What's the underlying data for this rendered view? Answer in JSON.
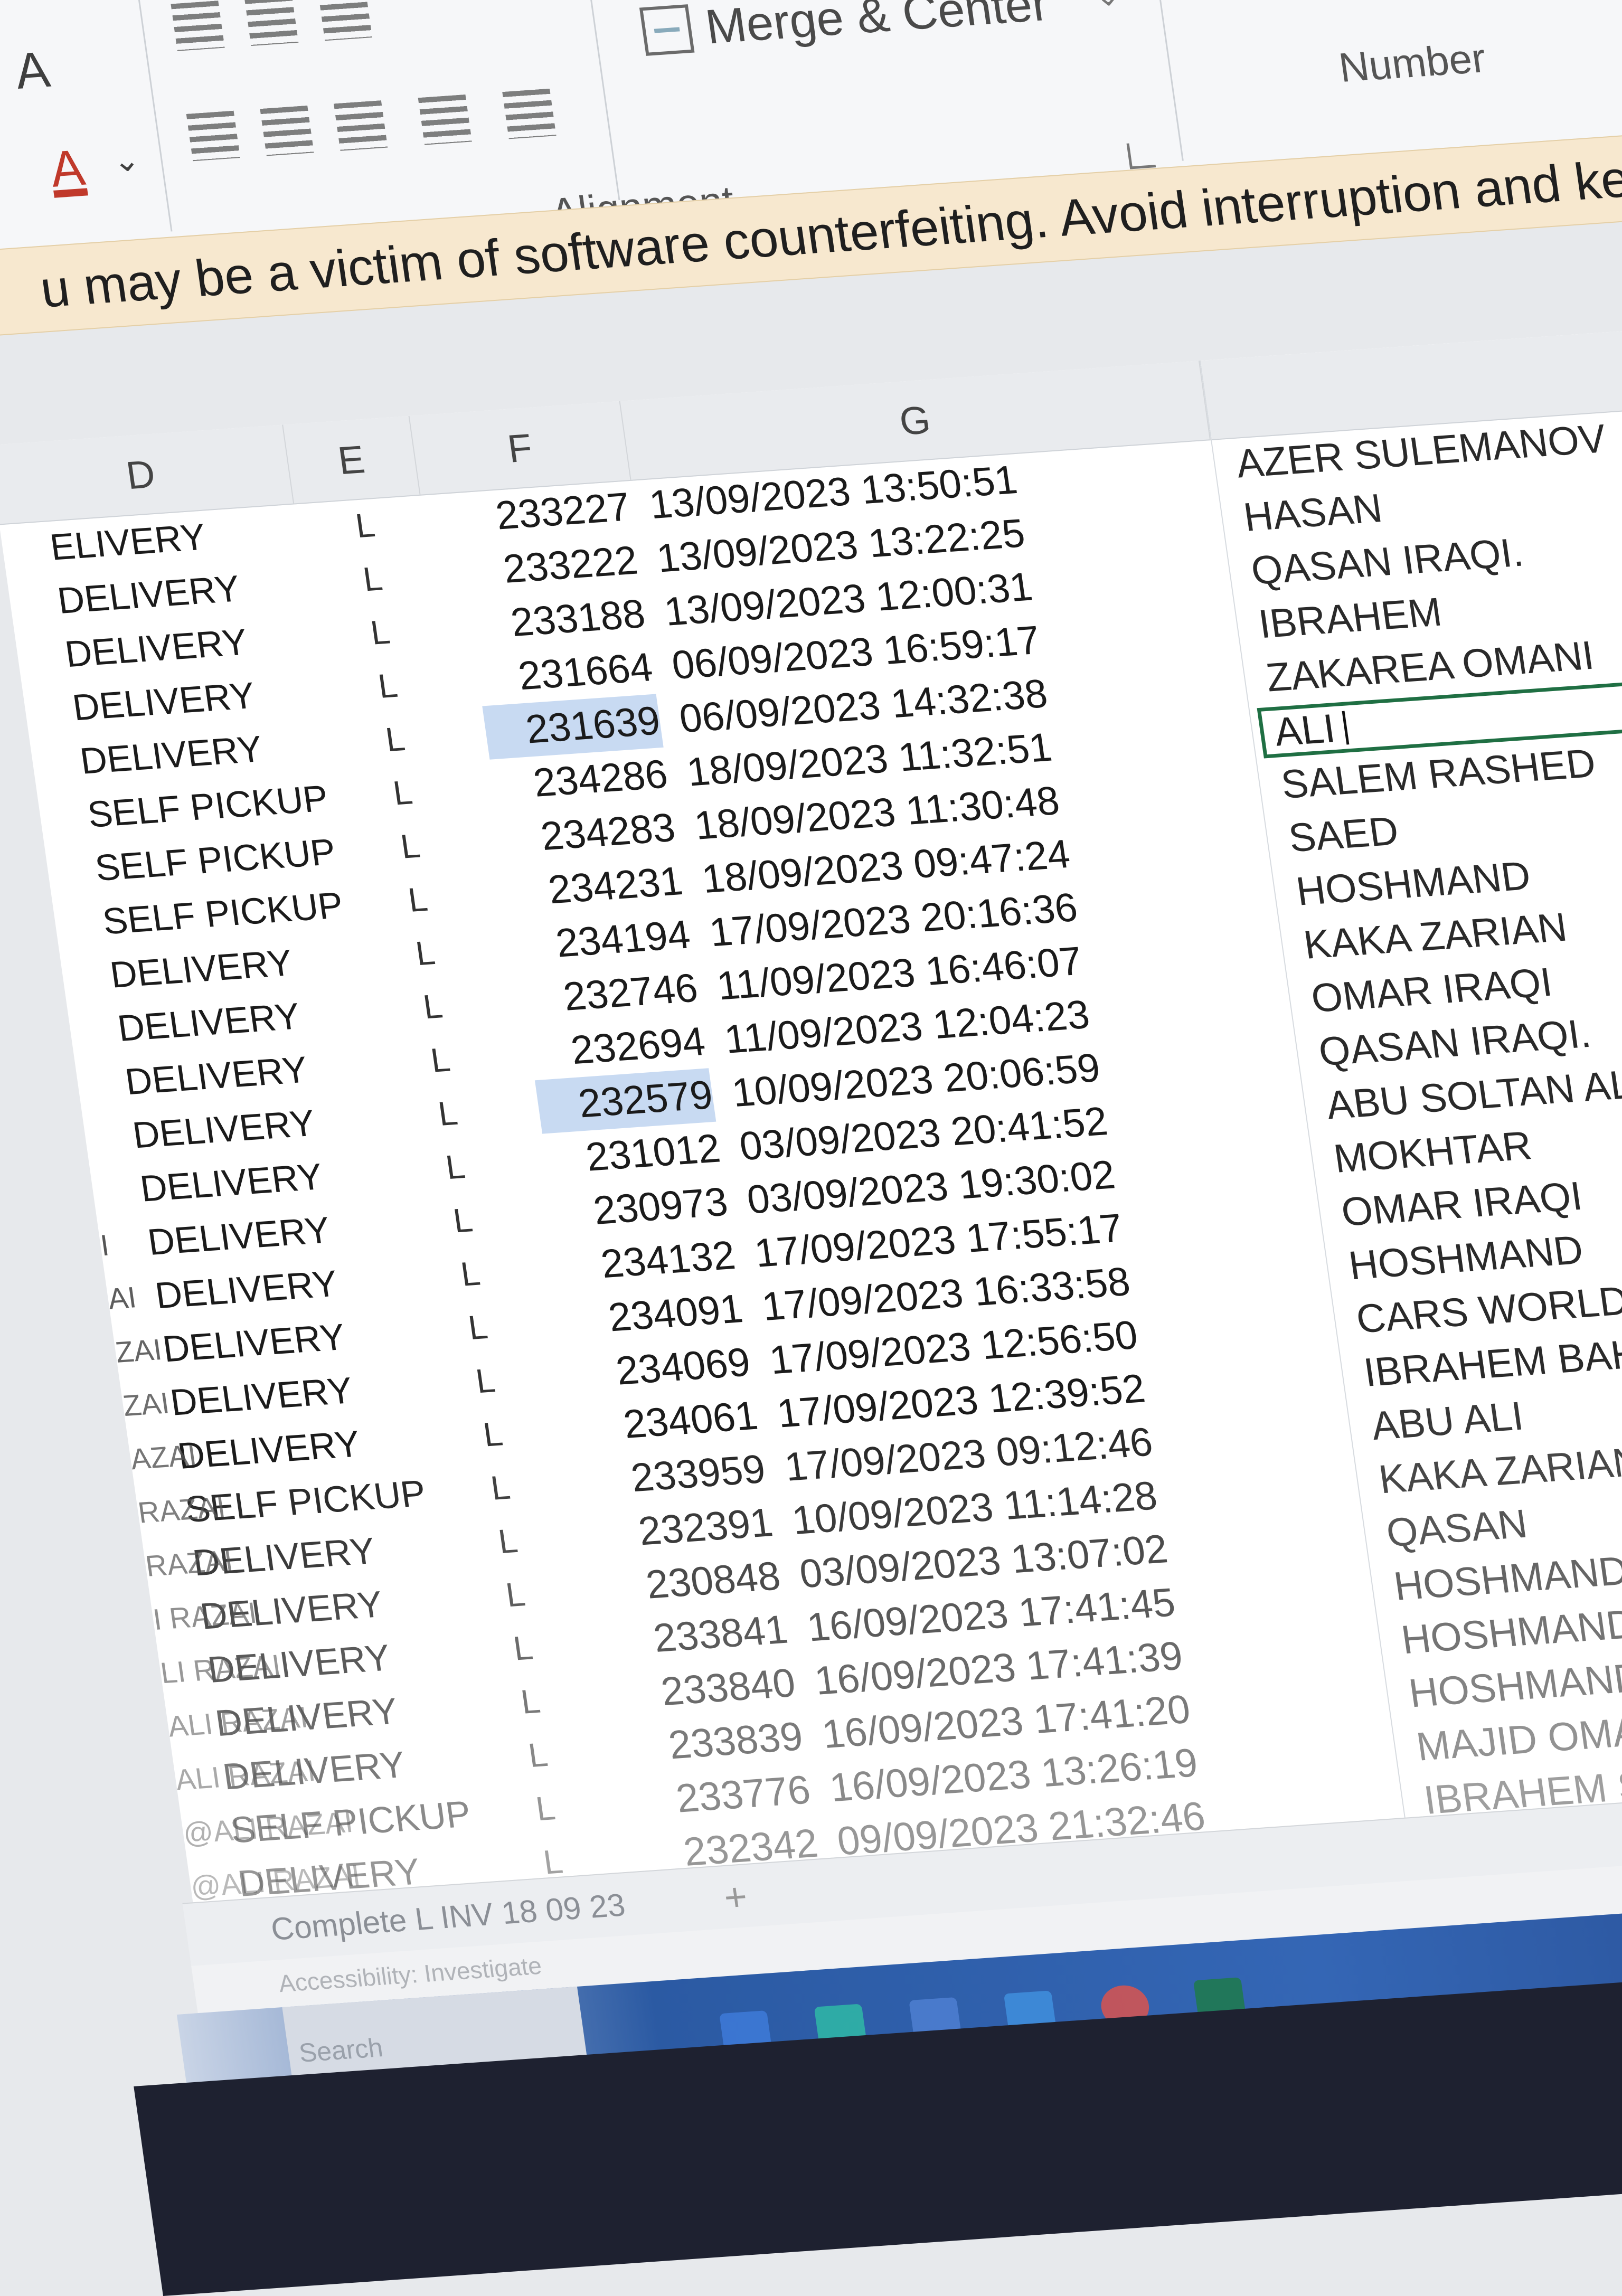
{
  "ribbon": {
    "font_grow_glyph": "A",
    "font_color_glyph": "A",
    "merge_label": "Merge & Center",
    "alignment_label": "Alignment",
    "number_label": "Number"
  },
  "warning": {
    "text": "u may be a victim of software counterfeiting. Avoid interruption and keep your files safe wit"
  },
  "columns": {
    "d": "D",
    "e": "E",
    "f": "F",
    "g": "G"
  },
  "rows": [
    {
      "d": "ELIVERY",
      "e": "L",
      "f": "233227",
      "g": "13/09/2023 13:50:51",
      "h": "AZER SULEMANOV"
    },
    {
      "d": "DELIVERY",
      "e": "L",
      "f": "233222",
      "g": "13/09/2023 13:22:25",
      "h": "HASAN"
    },
    {
      "d": "DELIVERY",
      "e": "L",
      "f": "233188",
      "g": "13/09/2023 12:00:31",
      "h": "QASAN IRAQI."
    },
    {
      "d": "DELIVERY",
      "e": "L",
      "f": "231664",
      "g": "06/09/2023 16:59:17",
      "h": "IBRAHEM"
    },
    {
      "d": "DELIVERY",
      "e": "L",
      "f": "231639",
      "g": "06/09/2023 14:32:38",
      "h": "ZAKAREA OMANI"
    },
    {
      "d": "SELF PICKUP",
      "e": "L",
      "f": "234286",
      "g": "18/09/2023 11:32:51",
      "h": "ALI"
    },
    {
      "d": "SELF PICKUP",
      "e": "L",
      "f": "234283",
      "g": "18/09/2023 11:30:48",
      "h": "SALEM RASHED"
    },
    {
      "d": "SELF PICKUP",
      "e": "L",
      "f": "234231",
      "g": "18/09/2023 09:47:24",
      "h": "SAED"
    },
    {
      "d": "DELIVERY",
      "e": "L",
      "f": "234194",
      "g": "17/09/2023 20:16:36",
      "h": "HOSHMAND"
    },
    {
      "d": "DELIVERY",
      "e": "L",
      "f": "232746",
      "g": "11/09/2023 16:46:07",
      "h": "KAKA ZARIAN"
    },
    {
      "d": "DELIVERY",
      "e": "L",
      "f": "232694",
      "g": "11/09/2023 12:04:23",
      "h": "OMAR IRAQI"
    },
    {
      "d": "DELIVERY",
      "e": "L",
      "f": "232579",
      "g": "10/09/2023 20:06:59",
      "h": "QASAN IRAQI."
    },
    {
      "d": "DELIVERY",
      "e": "L",
      "f": "231012",
      "g": "03/09/2023 20:41:52",
      "h": "ABU SOLTAN ALAIN"
    },
    {
      "d": "DELIVERY",
      "e": "L",
      "f": "230973",
      "g": "03/09/2023 19:30:02",
      "h": "MOKHTAR"
    },
    {
      "d": "DELIVERY",
      "e": "L",
      "f": "234132",
      "g": "17/09/2023 17:55:17",
      "h": "OMAR IRAQI"
    },
    {
      "d": "DELIVERY",
      "e": "L",
      "f": "234091",
      "g": "17/09/2023 16:33:58",
      "h": "HOSHMAND"
    },
    {
      "d": "DELIVERY",
      "e": "L",
      "f": "234069",
      "g": "17/09/2023 12:56:50",
      "h": "CARS WORLD USED CA"
    },
    {
      "d": "DELIVERY",
      "e": "L",
      "f": "234061",
      "g": "17/09/2023 12:39:52",
      "h": "IBRAHEM BAHI"
    },
    {
      "d": "SELF PICKUP",
      "e": "L",
      "f": "233959",
      "g": "17/09/2023 09:12:46",
      "h": "ABU ALI"
    },
    {
      "d": "DELIVERY",
      "e": "L",
      "f": "232391",
      "g": "10/09/2023 11:14:28",
      "h": "KAKA ZARIAN"
    },
    {
      "d": "DELIVERY",
      "e": "L",
      "f": "230848",
      "g": "03/09/2023 13:07:02",
      "h": "QASAN"
    },
    {
      "d": "DELIVERY",
      "e": "L",
      "f": "233841",
      "g": "16/09/2023 17:41:45",
      "h": "HOSHMAND"
    },
    {
      "d": "DELIVERY",
      "e": "L",
      "f": "233840",
      "g": "16/09/2023 17:41:39",
      "h": "HOSHMAND"
    },
    {
      "d": "DELIVERY",
      "e": "L",
      "f": "233839",
      "g": "16/09/2023 17:41:20",
      "h": "HOSHMAND"
    },
    {
      "d": "SELF PICKUP",
      "e": "L",
      "f": "233776",
      "g": "16/09/2023 13:26:19",
      "h": "MAJID OMANI (CUSTOM"
    },
    {
      "d": "DELIVERY",
      "e": "L",
      "f": "232342",
      "g": "09/09/2023 21:32:46",
      "h": "IBRAHEM SOLALE"
    }
  ],
  "left_fragments": [
    "I",
    "AI",
    "ZAI",
    "ZAI",
    "AZAI",
    "RAZAI",
    "RAZAI",
    "I RAZAI",
    "LI RAZAI",
    "ALI RAZAI",
    "ALI RAZAI",
    "@ALI RAZAI",
    "@ALI RAZAI"
  ],
  "active_cell_value": "ALI",
  "sheet_tab": "Complete L INV 18 09 23",
  "status": "Accessibility: Investigate",
  "taskbar": {
    "search_label": "Search"
  },
  "colors": {
    "selection": "#c8daf2",
    "active_border": "#1f6f43",
    "warning_bg": "#f7e8cf",
    "font_color_red": "#c0392b"
  }
}
